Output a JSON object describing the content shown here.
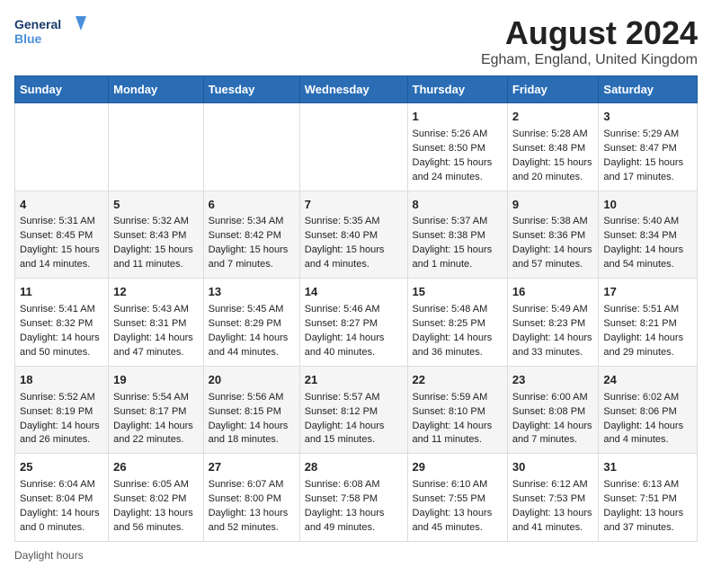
{
  "logo": {
    "line1": "General",
    "line2": "Blue"
  },
  "title": "August 2024",
  "subtitle": "Egham, England, United Kingdom",
  "days_of_week": [
    "Sunday",
    "Monday",
    "Tuesday",
    "Wednesday",
    "Thursday",
    "Friday",
    "Saturday"
  ],
  "weeks": [
    [
      {
        "num": "",
        "sunrise": "",
        "sunset": "",
        "daylight": ""
      },
      {
        "num": "",
        "sunrise": "",
        "sunset": "",
        "daylight": ""
      },
      {
        "num": "",
        "sunrise": "",
        "sunset": "",
        "daylight": ""
      },
      {
        "num": "",
        "sunrise": "",
        "sunset": "",
        "daylight": ""
      },
      {
        "num": "1",
        "sunrise": "Sunrise: 5:26 AM",
        "sunset": "Sunset: 8:50 PM",
        "daylight": "Daylight: 15 hours and 24 minutes."
      },
      {
        "num": "2",
        "sunrise": "Sunrise: 5:28 AM",
        "sunset": "Sunset: 8:48 PM",
        "daylight": "Daylight: 15 hours and 20 minutes."
      },
      {
        "num": "3",
        "sunrise": "Sunrise: 5:29 AM",
        "sunset": "Sunset: 8:47 PM",
        "daylight": "Daylight: 15 hours and 17 minutes."
      }
    ],
    [
      {
        "num": "4",
        "sunrise": "Sunrise: 5:31 AM",
        "sunset": "Sunset: 8:45 PM",
        "daylight": "Daylight: 15 hours and 14 minutes."
      },
      {
        "num": "5",
        "sunrise": "Sunrise: 5:32 AM",
        "sunset": "Sunset: 8:43 PM",
        "daylight": "Daylight: 15 hours and 11 minutes."
      },
      {
        "num": "6",
        "sunrise": "Sunrise: 5:34 AM",
        "sunset": "Sunset: 8:42 PM",
        "daylight": "Daylight: 15 hours and 7 minutes."
      },
      {
        "num": "7",
        "sunrise": "Sunrise: 5:35 AM",
        "sunset": "Sunset: 8:40 PM",
        "daylight": "Daylight: 15 hours and 4 minutes."
      },
      {
        "num": "8",
        "sunrise": "Sunrise: 5:37 AM",
        "sunset": "Sunset: 8:38 PM",
        "daylight": "Daylight: 15 hours and 1 minute."
      },
      {
        "num": "9",
        "sunrise": "Sunrise: 5:38 AM",
        "sunset": "Sunset: 8:36 PM",
        "daylight": "Daylight: 14 hours and 57 minutes."
      },
      {
        "num": "10",
        "sunrise": "Sunrise: 5:40 AM",
        "sunset": "Sunset: 8:34 PM",
        "daylight": "Daylight: 14 hours and 54 minutes."
      }
    ],
    [
      {
        "num": "11",
        "sunrise": "Sunrise: 5:41 AM",
        "sunset": "Sunset: 8:32 PM",
        "daylight": "Daylight: 14 hours and 50 minutes."
      },
      {
        "num": "12",
        "sunrise": "Sunrise: 5:43 AM",
        "sunset": "Sunset: 8:31 PM",
        "daylight": "Daylight: 14 hours and 47 minutes."
      },
      {
        "num": "13",
        "sunrise": "Sunrise: 5:45 AM",
        "sunset": "Sunset: 8:29 PM",
        "daylight": "Daylight: 14 hours and 44 minutes."
      },
      {
        "num": "14",
        "sunrise": "Sunrise: 5:46 AM",
        "sunset": "Sunset: 8:27 PM",
        "daylight": "Daylight: 14 hours and 40 minutes."
      },
      {
        "num": "15",
        "sunrise": "Sunrise: 5:48 AM",
        "sunset": "Sunset: 8:25 PM",
        "daylight": "Daylight: 14 hours and 36 minutes."
      },
      {
        "num": "16",
        "sunrise": "Sunrise: 5:49 AM",
        "sunset": "Sunset: 8:23 PM",
        "daylight": "Daylight: 14 hours and 33 minutes."
      },
      {
        "num": "17",
        "sunrise": "Sunrise: 5:51 AM",
        "sunset": "Sunset: 8:21 PM",
        "daylight": "Daylight: 14 hours and 29 minutes."
      }
    ],
    [
      {
        "num": "18",
        "sunrise": "Sunrise: 5:52 AM",
        "sunset": "Sunset: 8:19 PM",
        "daylight": "Daylight: 14 hours and 26 minutes."
      },
      {
        "num": "19",
        "sunrise": "Sunrise: 5:54 AM",
        "sunset": "Sunset: 8:17 PM",
        "daylight": "Daylight: 14 hours and 22 minutes."
      },
      {
        "num": "20",
        "sunrise": "Sunrise: 5:56 AM",
        "sunset": "Sunset: 8:15 PM",
        "daylight": "Daylight: 14 hours and 18 minutes."
      },
      {
        "num": "21",
        "sunrise": "Sunrise: 5:57 AM",
        "sunset": "Sunset: 8:12 PM",
        "daylight": "Daylight: 14 hours and 15 minutes."
      },
      {
        "num": "22",
        "sunrise": "Sunrise: 5:59 AM",
        "sunset": "Sunset: 8:10 PM",
        "daylight": "Daylight: 14 hours and 11 minutes."
      },
      {
        "num": "23",
        "sunrise": "Sunrise: 6:00 AM",
        "sunset": "Sunset: 8:08 PM",
        "daylight": "Daylight: 14 hours and 7 minutes."
      },
      {
        "num": "24",
        "sunrise": "Sunrise: 6:02 AM",
        "sunset": "Sunset: 8:06 PM",
        "daylight": "Daylight: 14 hours and 4 minutes."
      }
    ],
    [
      {
        "num": "25",
        "sunrise": "Sunrise: 6:04 AM",
        "sunset": "Sunset: 8:04 PM",
        "daylight": "Daylight: 14 hours and 0 minutes."
      },
      {
        "num": "26",
        "sunrise": "Sunrise: 6:05 AM",
        "sunset": "Sunset: 8:02 PM",
        "daylight": "Daylight: 13 hours and 56 minutes."
      },
      {
        "num": "27",
        "sunrise": "Sunrise: 6:07 AM",
        "sunset": "Sunset: 8:00 PM",
        "daylight": "Daylight: 13 hours and 52 minutes."
      },
      {
        "num": "28",
        "sunrise": "Sunrise: 6:08 AM",
        "sunset": "Sunset: 7:58 PM",
        "daylight": "Daylight: 13 hours and 49 minutes."
      },
      {
        "num": "29",
        "sunrise": "Sunrise: 6:10 AM",
        "sunset": "Sunset: 7:55 PM",
        "daylight": "Daylight: 13 hours and 45 minutes."
      },
      {
        "num": "30",
        "sunrise": "Sunrise: 6:12 AM",
        "sunset": "Sunset: 7:53 PM",
        "daylight": "Daylight: 13 hours and 41 minutes."
      },
      {
        "num": "31",
        "sunrise": "Sunrise: 6:13 AM",
        "sunset": "Sunset: 7:51 PM",
        "daylight": "Daylight: 13 hours and 37 minutes."
      }
    ]
  ],
  "footer": {
    "label": "Daylight hours"
  }
}
